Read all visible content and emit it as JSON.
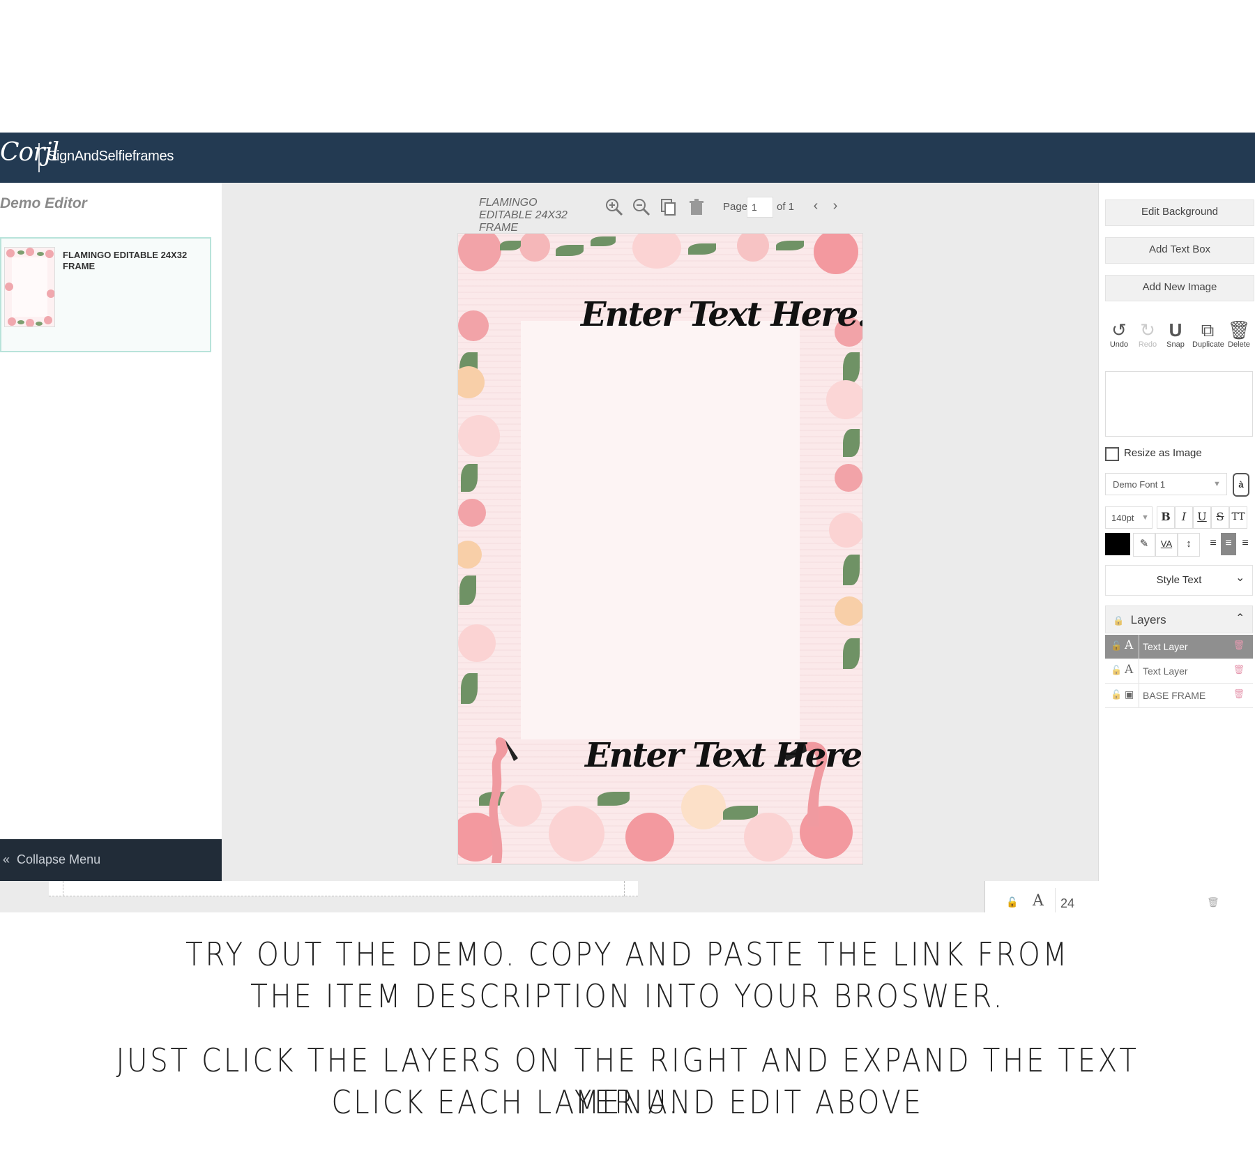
{
  "header": {
    "logo": "Corjl",
    "store": "SignAndSelfieframes"
  },
  "left_panel": {
    "title": "Demo Editor",
    "template_label": "FLAMINGO EDITABLE 24X32 FRAME",
    "collapse_label": "Collapse Menu",
    "collapse_icon": "«"
  },
  "toolbar": {
    "doc_name": "FLAMINGO EDITABLE 24X32 FRAME",
    "page_label": "Page",
    "page_value": "1",
    "page_of": "of 1",
    "prev_icon": "‹",
    "next_icon": "›"
  },
  "canvas": {
    "text_top": "Enter Text Here...",
    "text_bottom": "Enter Text Here..."
  },
  "right_panel": {
    "edit_background": "Edit Background",
    "add_text_box": "Add Text Box",
    "add_new_image": "Add New Image",
    "tools": {
      "undo": "Undo",
      "redo": "Redo",
      "snap": "Snap",
      "duplicate": "Duplicate",
      "delete": "Delete"
    },
    "resize_label": "Resize as Image",
    "resize_checked": false,
    "font_value": "Demo Font 1",
    "font_upload_icon": "à",
    "size_value": "140pt",
    "format": {
      "bold": "B",
      "italic": "I",
      "underline": "U",
      "strike": "S",
      "caps": "TT"
    },
    "color": "#000000",
    "spacing": "VA",
    "style_text": "Style Text",
    "layers_title": "Layers",
    "layers": [
      {
        "type_icon": "A",
        "name": "Text Layer",
        "selected": true
      },
      {
        "type_icon": "A",
        "name": "Text Layer",
        "selected": false
      },
      {
        "type_icon": "image-icon",
        "name": "BASE FRAME",
        "selected": false
      }
    ]
  },
  "ghost_row": {
    "type_icon": "A",
    "value": "24"
  },
  "instructions": {
    "line1": "TRY OUT THE DEMO. COPY AND PASTE THE LINK FROM",
    "line2": "THE ITEM DESCRIPTION INTO YOUR BROSWER.",
    "line3": "JUST CLICK THE LAYERS ON THE RIGHT AND EXPAND THE TEXT MENU.",
    "line4": "CLICK EACH LAYER AND EDIT ABOVE"
  },
  "colors": {
    "topbar": "#233a52",
    "collapse_bar": "#212c38",
    "card_border": "#b8e3da",
    "selected_layer": "#8f8f8f"
  }
}
